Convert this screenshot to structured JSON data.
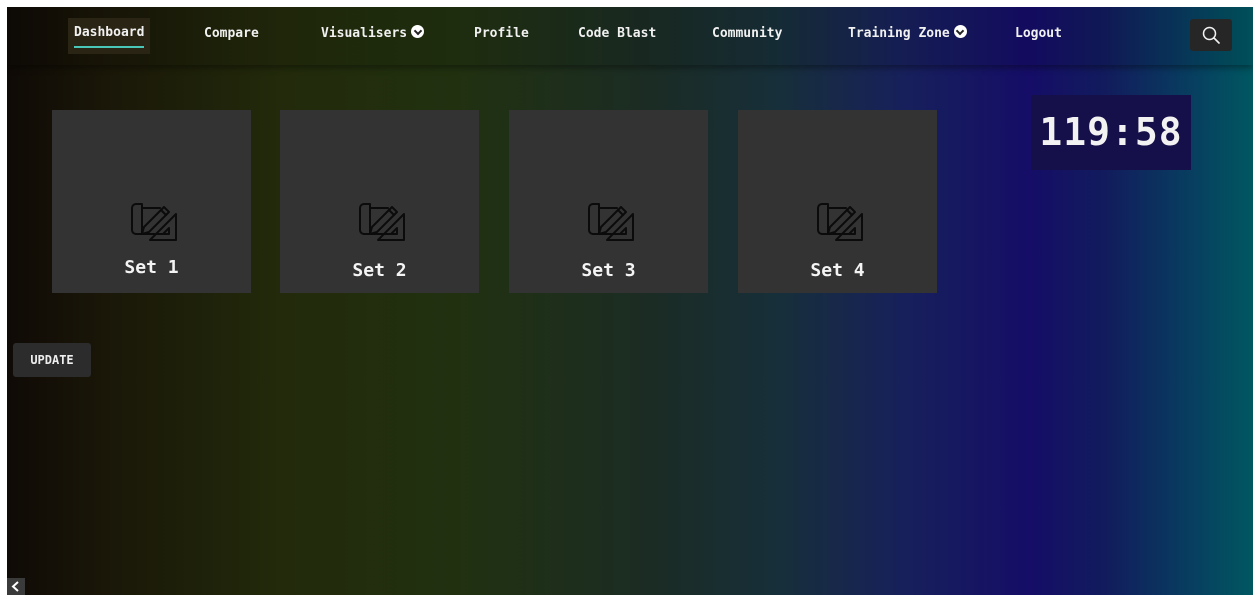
{
  "nav": {
    "items": [
      {
        "label": "Dashboard",
        "active": true
      },
      {
        "label": "Compare"
      },
      {
        "label": "Visualisers",
        "dropdown": true
      },
      {
        "label": "Profile"
      },
      {
        "label": "Code Blast"
      },
      {
        "label": "Community"
      },
      {
        "label": "Training Zone",
        "dropdown": true
      },
      {
        "label": "Logout"
      }
    ],
    "search_icon": "search-icon",
    "accent_color": "#49c6b8"
  },
  "sets": [
    {
      "label": "Set 1",
      "icon": "blueprint-pencil-icon"
    },
    {
      "label": "Set 2",
      "icon": "blueprint-pencil-icon"
    },
    {
      "label": "Set 3",
      "icon": "blueprint-pencil-icon"
    },
    {
      "label": "Set 4",
      "icon": "blueprint-pencil-icon"
    }
  ],
  "timer": {
    "value": "119:58"
  },
  "update_button": {
    "label": "UPDATE"
  },
  "sidebar_toggle": {
    "icon": "chevron-left-icon"
  }
}
